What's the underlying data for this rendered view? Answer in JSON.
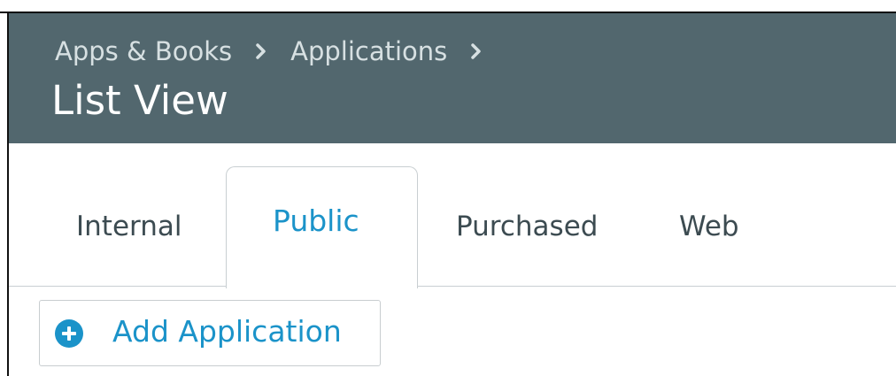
{
  "breadcrumb": {
    "items": [
      "Apps & Books",
      "Applications"
    ]
  },
  "page": {
    "title": "List View"
  },
  "tabs": [
    {
      "label": "Internal",
      "active": false
    },
    {
      "label": "Public",
      "active": true
    },
    {
      "label": "Purchased",
      "active": false
    },
    {
      "label": "Web",
      "active": false
    }
  ],
  "toolbar": {
    "add_application_label": "Add Application",
    "add_icon": "plus-circle-icon"
  },
  "colors": {
    "header_bg": "#52676e",
    "accent": "#1b93c9",
    "breadcrumb_text": "#d7e0e2",
    "tab_text": "#3c4b51"
  }
}
